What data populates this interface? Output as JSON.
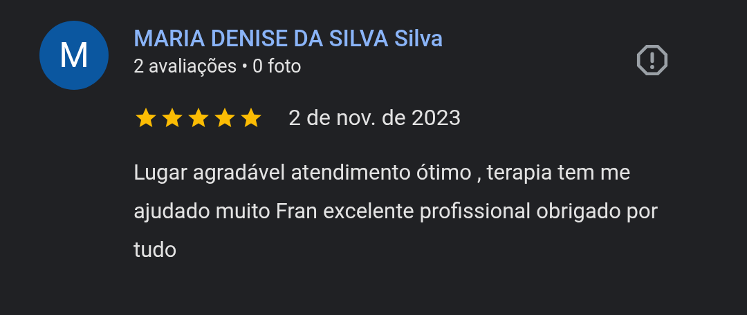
{
  "review": {
    "avatar_letter": "M",
    "author": "MARIA DENISE DA SILVA Silva",
    "meta": "2 avaliações • 0 foto",
    "stars": 5,
    "date": "2 de nov. de 2023",
    "text": "Lugar agradável atendimento ótimo , terapia tem me ajudado muito Fran excelente profissional obrigado por tudo"
  }
}
